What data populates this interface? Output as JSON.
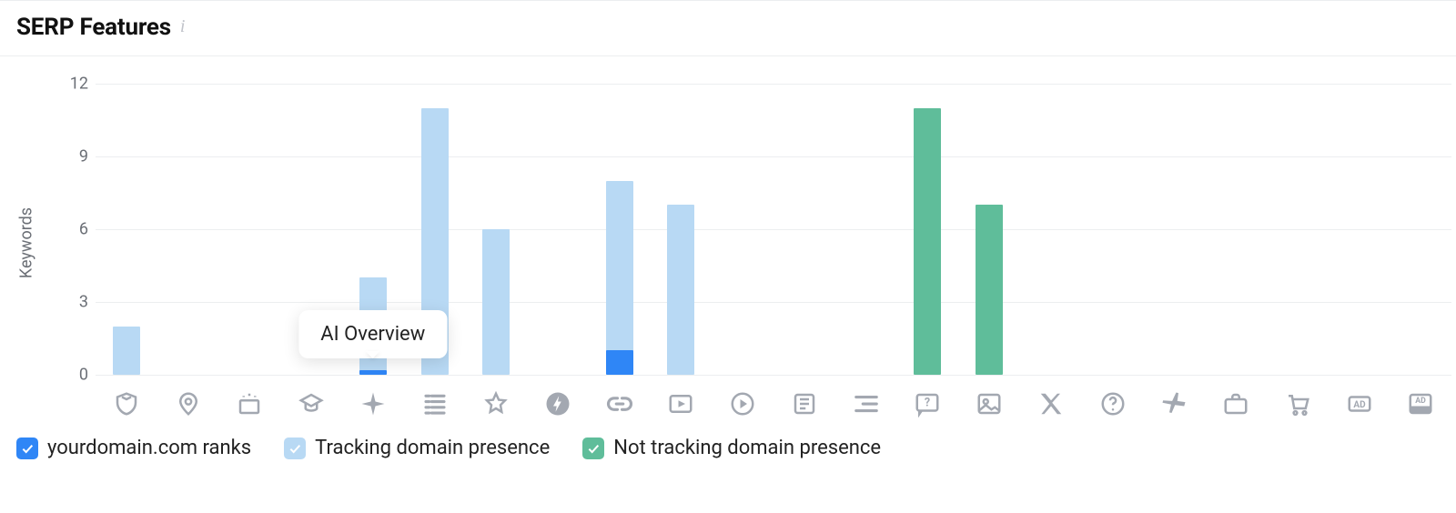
{
  "header": {
    "title": "SERP Features"
  },
  "legend": {
    "items": [
      {
        "key": "ranks",
        "label": "yourdomain.com ranks"
      },
      {
        "key": "presence",
        "label": "Tracking domain presence"
      },
      {
        "key": "nottrack",
        "label": "Not tracking domain presence"
      }
    ]
  },
  "tooltip": {
    "text": "AI Overview",
    "slot_index": 4
  },
  "chart_data": {
    "type": "bar",
    "ylabel": "Keywords",
    "ylim": [
      0,
      12
    ],
    "yticks": [
      0,
      3,
      6,
      9,
      12
    ],
    "categories": [
      "featured-snippet",
      "local-pack",
      "ai-overviews-list",
      "knowledge-panel",
      "ai-overview",
      "sitelinks",
      "reviews",
      "amp",
      "link",
      "video",
      "video-carousel",
      "news",
      "indented",
      "faq",
      "image",
      "twitter",
      "questions",
      "flights",
      "jobs",
      "shopping",
      "ads",
      "ads-bottom"
    ],
    "series": [
      {
        "name": "yourdomain.com ranks",
        "key": "ranks",
        "values": [
          0,
          0,
          0,
          0,
          0.2,
          0,
          0,
          0,
          1,
          0,
          0,
          0,
          0,
          0,
          0,
          0,
          0,
          0,
          0,
          0,
          0,
          0
        ]
      },
      {
        "name": "Tracking domain presence",
        "key": "presence",
        "values": [
          2,
          0,
          0,
          0,
          4,
          11,
          6,
          0,
          8,
          7,
          0,
          0,
          0,
          0,
          0,
          0,
          0,
          0,
          0,
          0,
          0,
          0
        ]
      },
      {
        "name": "Not tracking domain presence",
        "key": "nottrack",
        "values": [
          0,
          0,
          0,
          0,
          0,
          0,
          0,
          0,
          0,
          0,
          0,
          0,
          0,
          11,
          7,
          0,
          0,
          0,
          0,
          0,
          0,
          0
        ]
      }
    ]
  }
}
